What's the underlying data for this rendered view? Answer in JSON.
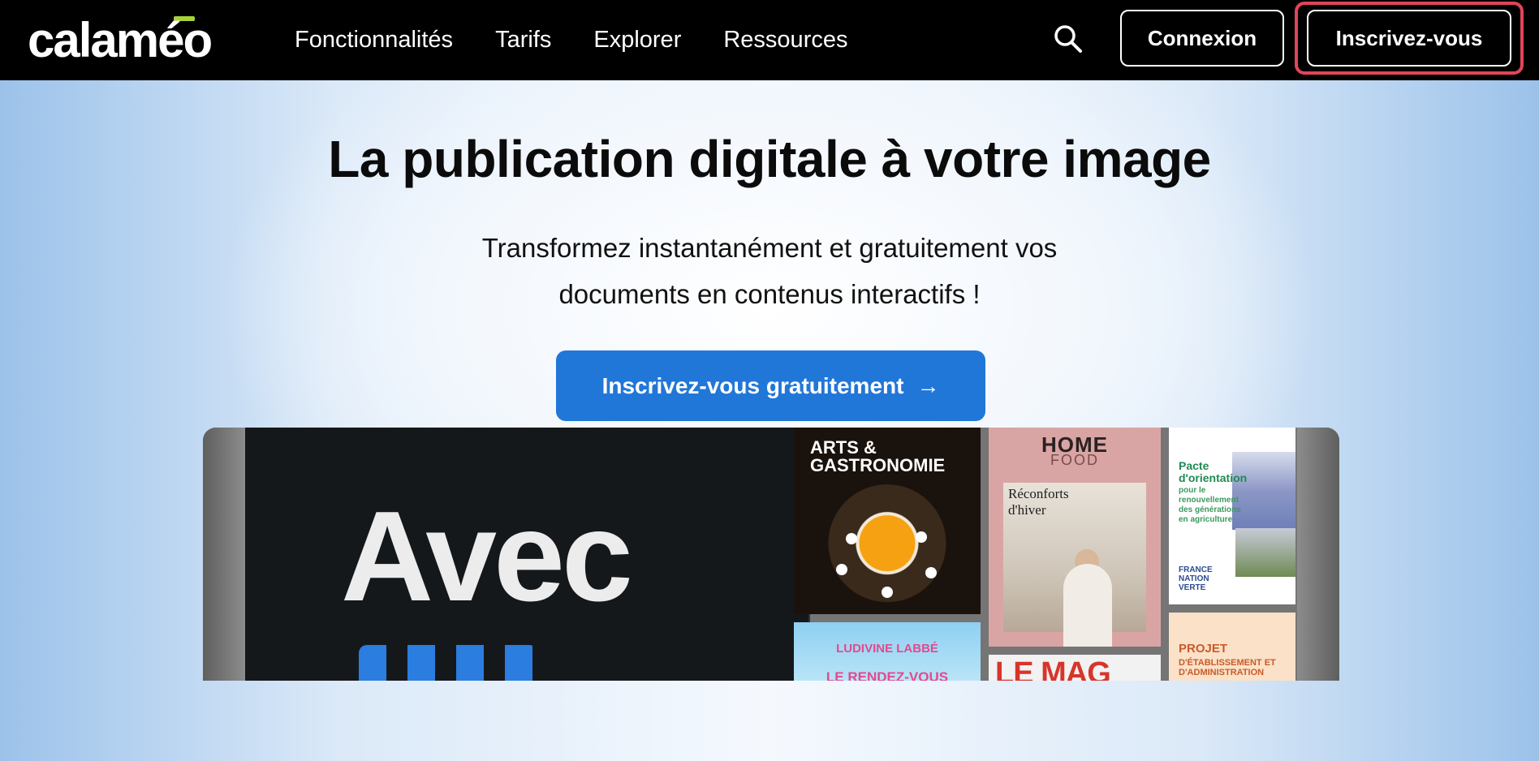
{
  "nav": {
    "logo_text": "calaméo",
    "links": [
      "Fonctionnalités",
      "Tarifs",
      "Explorer",
      "Ressources"
    ],
    "login_label": "Connexion",
    "signup_label": "Inscrivez-vous"
  },
  "hero": {
    "title": "La publication digitale à votre image",
    "subtitle_line1": "Transformez instantanément et gratuitement vos",
    "subtitle_line2": "documents en contenus interactifs !",
    "cta_label": "Inscrivez-vous gratuitement",
    "cta_arrow": "→"
  },
  "showcase": {
    "big_text": "Avec",
    "magazines": {
      "arts_title_1": "ARTS &",
      "arts_title_2": "GASTRONOMIE",
      "home_title": "HOME",
      "home_sub": "FOOD",
      "home_headline": "Réconforts d'hiver",
      "ludivine_title": "LUDIVINE LABBÉ",
      "ludivine_sub": "LE RENDEZ-VOUS",
      "lemag_title": "LE MAG",
      "pacte_title": "Pacte d'orientation",
      "pacte_sub": "pour le renouvellement des générations en agriculture",
      "pacte_footer": "FRANCE NATION VERTE",
      "projet_title": "PROJET",
      "projet_sub": "D'ÉTABLISSEMENT ET D'ADMINISTRATION"
    }
  },
  "colors": {
    "nav_bg": "#000000",
    "cta_bg": "#2177d8",
    "highlight": "#e04558",
    "logo_accent": "#a6d23a"
  }
}
